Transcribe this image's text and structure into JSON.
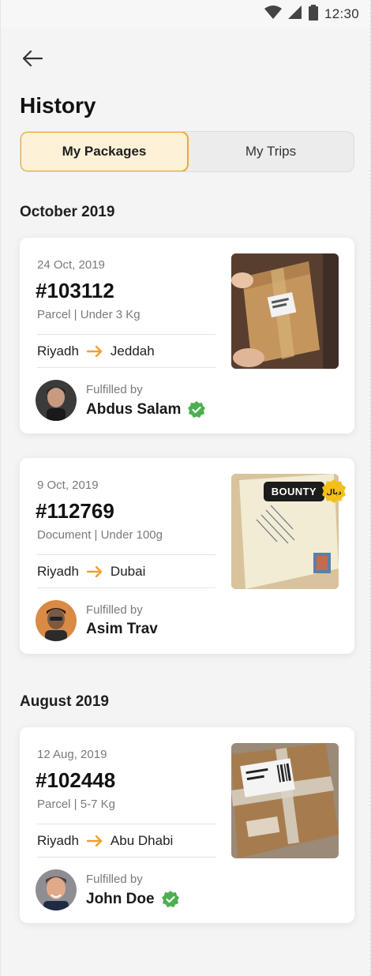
{
  "status_bar": {
    "time": "12:30"
  },
  "header": {
    "title": "History"
  },
  "tabs": [
    {
      "label": "My Packages",
      "active": true
    },
    {
      "label": "My Trips",
      "active": false
    }
  ],
  "sections": [
    {
      "title": "October 2019",
      "cards": [
        {
          "date": "24 Oct, 2019",
          "id": "#103112",
          "meta": "Parcel | Under 3 Kg",
          "from": "Riyadh",
          "to": "Jeddah",
          "fulfilled_label": "Fulfilled by",
          "fulfilled_name": "Abdus Salam",
          "verified": true,
          "image": "parcel-box-photo"
        },
        {
          "date": "9 Oct, 2019",
          "id": "#112769",
          "meta": "Document | Under 100g",
          "from": "Riyadh",
          "to": "Dubai",
          "fulfilled_label": "Fulfilled by",
          "fulfilled_name": "Asim Trav",
          "verified": false,
          "image": "envelope-photo",
          "badge": "BOUNTY"
        }
      ]
    },
    {
      "title": "August 2019",
      "cards": [
        {
          "date": "12 Aug, 2019",
          "id": "#102448",
          "meta": "Parcel | 5-7 Kg",
          "from": "Riyadh",
          "to": "Abu Dhabi",
          "fulfilled_label": "Fulfilled by",
          "fulfilled_name": "John Doe",
          "verified": true,
          "image": "shipping-box-photo"
        }
      ]
    }
  ],
  "colors": {
    "accent": "#e9a93c",
    "accent_bg": "#fdf1d8",
    "verified": "#4caf50",
    "route_arrow": "#f0a030"
  }
}
